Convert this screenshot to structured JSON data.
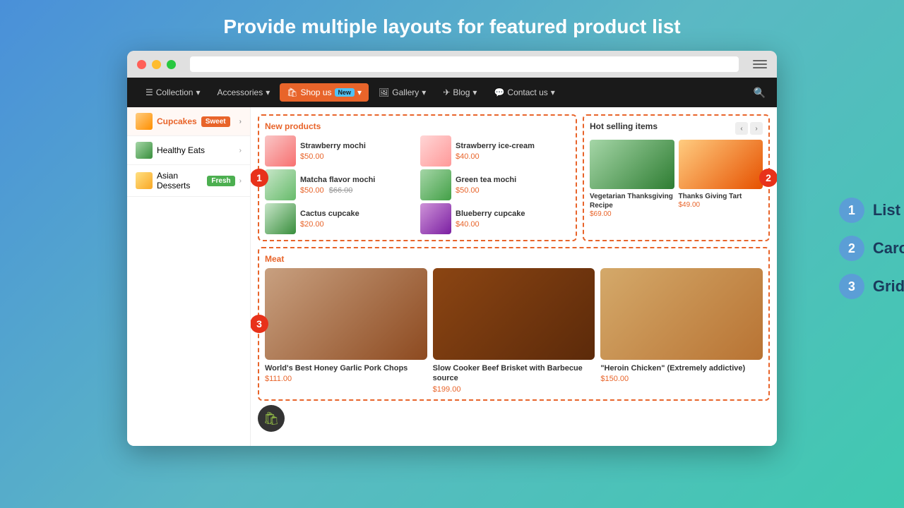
{
  "page": {
    "title": "Provide multiple layouts for featured product list"
  },
  "nav": {
    "items": [
      {
        "label": "Collection",
        "active": false,
        "icon": "☰",
        "has_arrow": true
      },
      {
        "label": "Accessories",
        "active": false,
        "has_arrow": true
      },
      {
        "label": "Shop us",
        "active": true,
        "badge": "New",
        "icon": "🛍",
        "has_arrow": true
      },
      {
        "label": "Gallery",
        "active": false,
        "icon": "🖼",
        "has_arrow": true
      },
      {
        "label": "Blog",
        "active": false,
        "icon": "✈",
        "has_arrow": true
      },
      {
        "label": "Contact us",
        "active": false,
        "icon": "💬",
        "has_arrow": true
      }
    ]
  },
  "sidebar": {
    "items": [
      {
        "label": "Cupcakes",
        "badge": "Sweet",
        "badge_type": "sweet",
        "has_arrow": true
      },
      {
        "label": "Healthy Eats",
        "has_arrow": true
      },
      {
        "label": "Asian Desserts",
        "badge": "Fresh",
        "badge_type": "fresh",
        "has_arrow": true
      }
    ]
  },
  "new_products": {
    "title": "New products",
    "items": [
      {
        "name": "Strawberry mochi",
        "price": "$50.00",
        "img_class": "img-strawberry-mochi"
      },
      {
        "name": "Strawberry ice-cream",
        "price": "$40.00",
        "img_class": "img-strawberry-icecream"
      },
      {
        "name": "Matcha flavor mochi",
        "price": "$50.00",
        "old_price": "$66.00",
        "img_class": "img-matcha"
      },
      {
        "name": "Green tea mochi",
        "price": "$50.00",
        "img_class": "img-green-tea-mochi"
      },
      {
        "name": "Cactus cupcake",
        "price": "$20.00",
        "img_class": "img-cactus-cupcake"
      },
      {
        "name": "Blueberry cupcake",
        "price": "$40.00",
        "img_class": "img-blueberry"
      }
    ]
  },
  "hot_selling": {
    "title": "Hot selling items",
    "items": [
      {
        "name": "Vegetarian Thanksgiving Recipe",
        "price": "$69.00",
        "img_class": "img-veg-thanksgiving"
      },
      {
        "name": "Thanks Giving Tart",
        "price": "$49.00",
        "img_class": "img-pie"
      }
    ]
  },
  "meat": {
    "title": "Meat",
    "items": [
      {
        "name": "World's Best Honey Garlic Pork Chops",
        "price": "$111.00",
        "img_class": "img-pork"
      },
      {
        "name": "Slow Cooker Beef Brisket with Barbecue source",
        "price": "$199.00",
        "img_class": "img-beef"
      },
      {
        "name": "\"Heroin Chicken\" (Extremely addictive)",
        "price": "$150.00",
        "img_class": "img-chicken"
      }
    ]
  },
  "legend": {
    "items": [
      {
        "number": "1",
        "label": "List"
      },
      {
        "number": "2",
        "label": "Carousel"
      },
      {
        "number": "3",
        "label": "Grid"
      }
    ]
  },
  "badges": {
    "badge1": "1",
    "badge2": "2",
    "badge3": "3"
  }
}
